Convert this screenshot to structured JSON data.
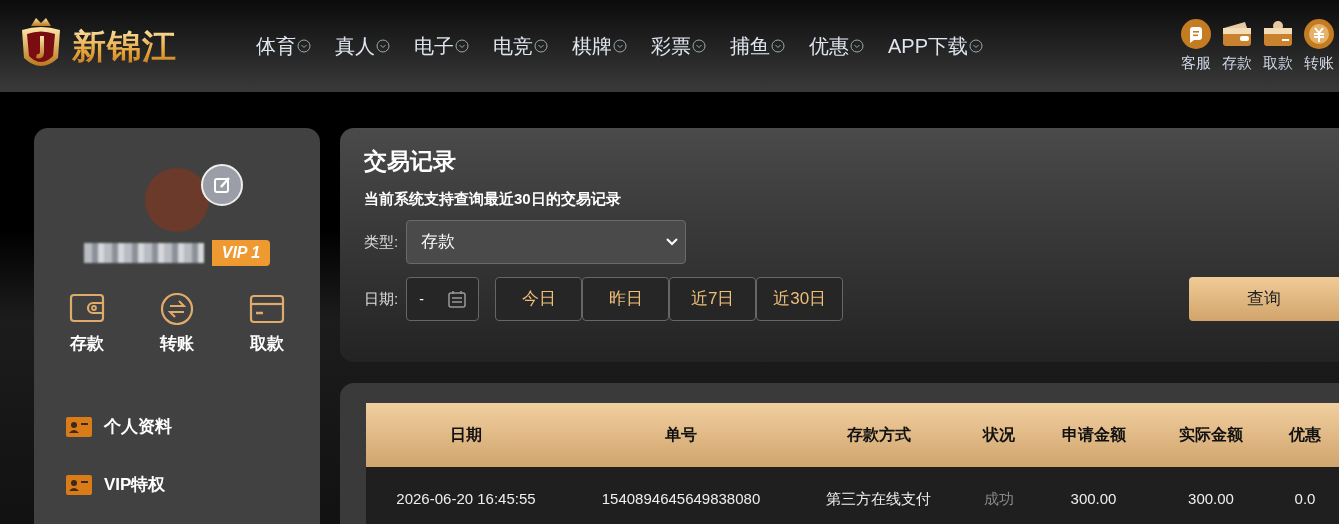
{
  "header": {
    "logo_text": "新锦江",
    "nav": [
      {
        "label": "体育"
      },
      {
        "label": "真人"
      },
      {
        "label": "电子"
      },
      {
        "label": "电竞"
      },
      {
        "label": "棋牌"
      },
      {
        "label": "彩票"
      },
      {
        "label": "捕鱼"
      },
      {
        "label": "优惠"
      },
      {
        "label": "APP下载"
      }
    ],
    "actions": [
      {
        "kind": "service",
        "label": "客服"
      },
      {
        "kind": "deposit",
        "label": "存款"
      },
      {
        "kind": "withdraw",
        "label": "取款"
      },
      {
        "kind": "transfer",
        "label": "转账"
      }
    ]
  },
  "sidebar": {
    "vip_badge": "VIP 1",
    "quick_actions": [
      {
        "kind": "wallet",
        "label": "存款"
      },
      {
        "kind": "transfer",
        "label": "转账"
      },
      {
        "kind": "card",
        "label": "取款"
      }
    ],
    "menu": [
      {
        "label": "个人资料"
      },
      {
        "label": "VIP特权"
      }
    ]
  },
  "filter": {
    "title": "交易记录",
    "note": "当前系统支持查询最近30日的交易记录",
    "type_label": "类型:",
    "type_value": "存款",
    "date_label": "日期:",
    "date_value": "-",
    "ranges": [
      {
        "label": "今日"
      },
      {
        "label": "昨日"
      },
      {
        "label": "近7日"
      },
      {
        "label": "近30日"
      }
    ],
    "query_button": "查询"
  },
  "table": {
    "columns": [
      "日期",
      "单号",
      "存款方式",
      "状况",
      "申请金额",
      "实际金额",
      "优惠"
    ],
    "rows": [
      [
        "2026-06-20 16:45:55",
        "1540894645649838080",
        "第三方在线支付",
        "成功",
        "300.00",
        "300.00",
        "0.0"
      ]
    ]
  }
}
